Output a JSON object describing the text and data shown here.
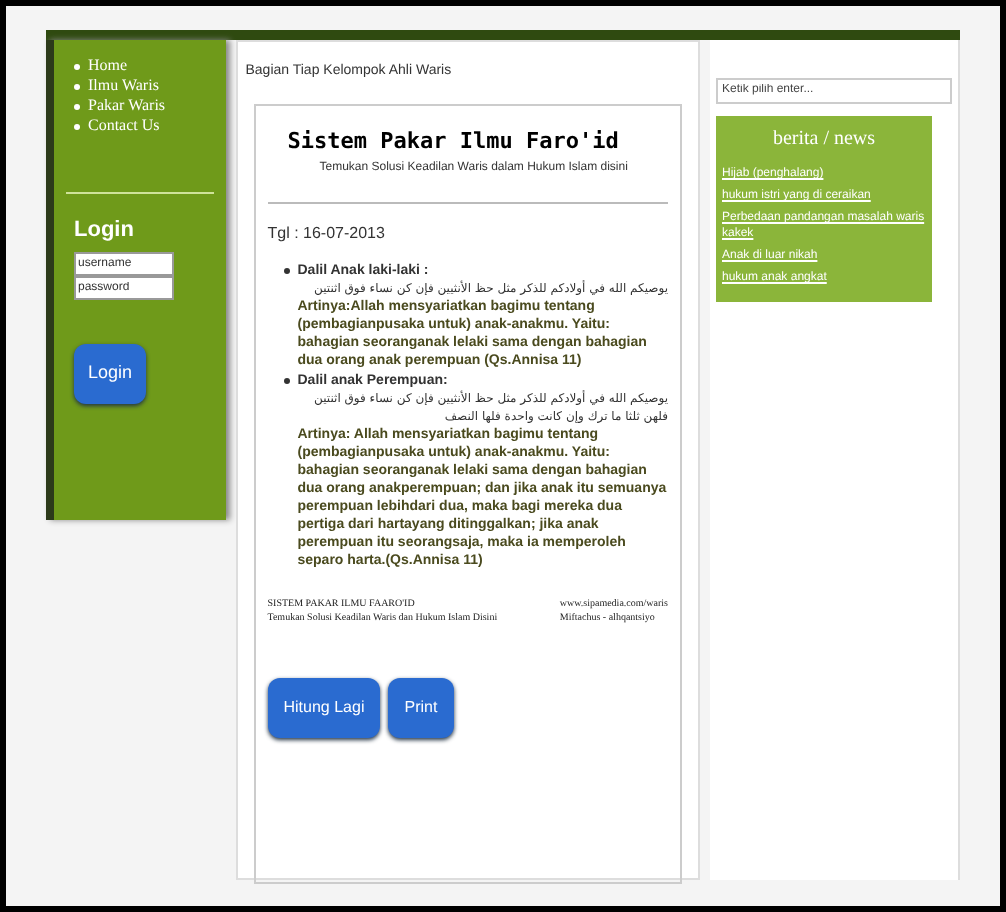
{
  "nav": {
    "items": [
      "Home",
      "Ilmu Waris",
      "Pakar Waris",
      "Contact Us"
    ]
  },
  "login": {
    "title": "Login",
    "username": {
      "value": "username"
    },
    "password": {
      "value": "password"
    },
    "button": "Login"
  },
  "breadcrumb": "Bagian Tiap Kelompok Ahli Waris",
  "report": {
    "title": "Sistem Pakar Ilmu Faro'id",
    "subtitle": "Temukan Solusi Keadilan Waris dalam Hukum Islam disini",
    "date": "Tgl : 16-07-2013",
    "items": [
      {
        "heading": "Dalil Anak laki-laki :",
        "arabic": "يوصيكم الله في أولادكم للذكر مثل حظ الأنثيين فإن كن نساء فوق اثنتين",
        "meaning": "Artinya:Allah mensyariatkan bagimu tentang (pembagianpusaka untuk) anak-anakmu. Yaitu: bahagian seoranganak lelaki sama dengan bahagian dua orang anak perempuan (Qs.Annisa 11)"
      },
      {
        "heading": "Dalil anak Perempuan:",
        "arabic": "يوصيكم الله في أولادكم للذكر مثل حظ الأنثيين فإن كن نساء فوق اثنتين فلهن ثلثا ما ترك وإن كانت واحدة فلها النصف",
        "meaning": "Artinya: Allah mensyariatkan bagimu tentang (pembagianpusaka untuk) anak-anakmu. Yaitu: bahagian seoranganak lelaki sama dengan bahagian dua orang anakperempuan; dan jika anak itu semuanya perempuan lebihdari dua, maka bagi mereka dua pertiga dari hartayang ditinggalkan; jika anak perempuan itu seorangsaja, maka ia memperoleh separo harta.(Qs.Annisa 11)"
      }
    ],
    "footer_left": [
      "SISTEM PAKAR ILMU FAARO'ID",
      "Temukan Solusi Keadilan Waris dan Hukum Islam Disini"
    ],
    "footer_right": [
      "www.sipamedia.com/waris",
      "Miftachus - alhqantsiyo"
    ]
  },
  "buttons": [
    "Hitung Lagi",
    "Print"
  ],
  "search": {
    "placeholder": "Ketik pilih enter..."
  },
  "news": {
    "title": "berita / news",
    "links": [
      "Hijab (penghalang)",
      "hukum istri yang di ceraikan",
      "Perbedaan pandangan masalah waris kakek",
      "Anak di luar nikah",
      "hukum anak angkat"
    ]
  }
}
